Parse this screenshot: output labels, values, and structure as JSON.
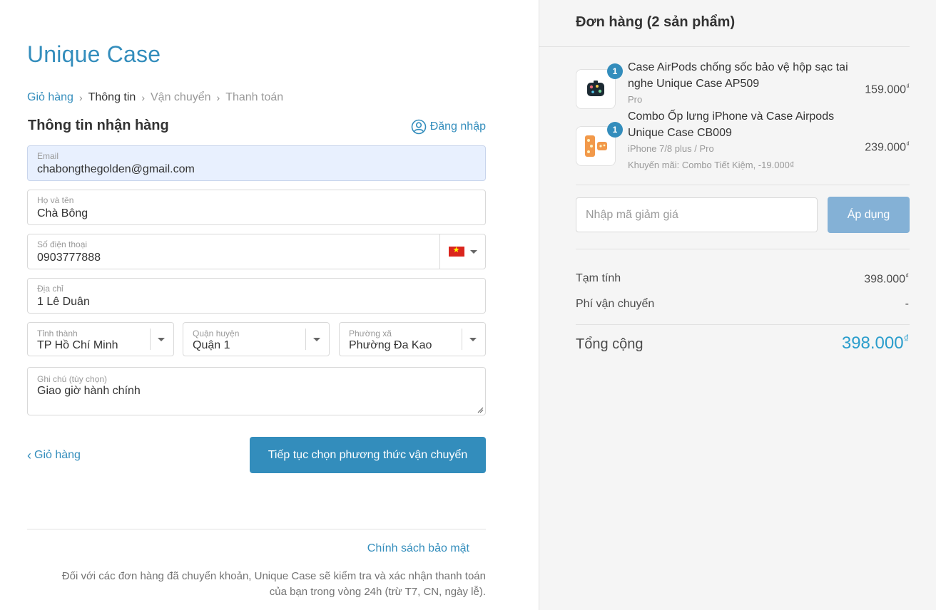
{
  "checkout": {
    "brand": "Unique Case",
    "breadcrumb": [
      "Giỏ hàng",
      "Thông tin",
      "Vận chuyển",
      "Thanh toán"
    ],
    "section_title": "Thông tin nhận hàng",
    "login_label": "Đăng nhập",
    "email": {
      "label": "Email",
      "value": "chabongthegolden@gmail.com"
    },
    "fullname": {
      "label": "Họ và tên",
      "value": "Chà Bông"
    },
    "phone": {
      "label": "Số điện thoại",
      "value": "0903777888",
      "country": "VN"
    },
    "address": {
      "label": "Địa chỉ",
      "value": "1 Lê Duân"
    },
    "province": {
      "label": "Tỉnh thành",
      "value": "TP Hồ Chí Minh"
    },
    "district": {
      "label": "Quận huyện",
      "value": "Quận 1"
    },
    "ward": {
      "label": "Phường xã",
      "value": "Phường Đa Kao"
    },
    "note": {
      "label": "Ghi chú (tùy chọn)",
      "value": "Giao giờ hành chính"
    },
    "back_label": "Giỏ hàng",
    "continue_label": "Tiếp tục chọn phương thức vận chuyển",
    "policy_label": "Chính sách bảo mật",
    "footer_note_1": "Đối với các đơn hàng đã chuyển khoản, Unique Case sẽ kiểm tra và xác nhận thanh toán",
    "footer_note_2": "của bạn trong vòng 24h (trừ T7, CN, ngày lễ)."
  },
  "order": {
    "title": "Đơn hàng (2 sản phẩm)",
    "items": [
      {
        "qty": "1",
        "name": "Case AirPods chống sốc bảo vệ hộp sạc tai nghe Unique Case AP509",
        "variant": "Pro",
        "price": "159.000",
        "currency": "₫",
        "discount": ""
      },
      {
        "qty": "1",
        "name": "Combo Ốp lưng iPhone và Case Airpods Unique Case CB009",
        "variant": "iPhone 7/8 plus / Pro",
        "price": "239.000",
        "currency": "₫",
        "discount": "Khuyến mãi: Combo Tiết Kiệm, -19.000₫"
      }
    ],
    "coupon_placeholder": "Nhập mã giảm giá",
    "apply_label": "Áp dụng",
    "subtotal_label": "Tạm tính",
    "subtotal_value": "398.000",
    "shipping_label": "Phí vận chuyển",
    "shipping_value": "-",
    "total_label": "Tổng cộng",
    "total_value": "398.000",
    "currency": "₫"
  },
  "colors": {
    "accent": "#338dbc",
    "total": "#2a9dcc",
    "apply_button": "#84b1d6",
    "autofill_bg": "#e8f0fe"
  },
  "icons": [
    "user-circle-icon",
    "vietnam-flag-icon",
    "chevron-down-icon",
    "chevron-left-icon",
    "chevron-right-icon",
    "resize-handle-icon",
    "qty-badge"
  ]
}
